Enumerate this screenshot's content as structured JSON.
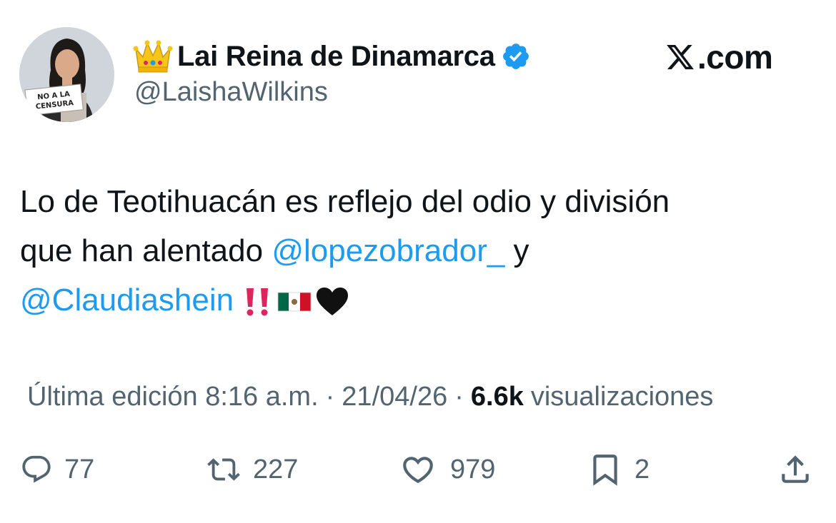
{
  "author": {
    "display_name": "Lai Reina de Dinamarca",
    "handle": "@LaishaWilkins",
    "avatar_sign_text": [
      "NO A LA",
      "CENSURA"
    ],
    "name_prefix_icon": "crown-emoji",
    "verified": true
  },
  "site": {
    "label": ".com",
    "logo_icon": "x-logo"
  },
  "tweet": {
    "lines": [
      {
        "text": "Lo de Teotihuacán es reflejo del odio y división"
      },
      {
        "text": "que han alentado ",
        "mention": "@lopezobrador_",
        "suffix": " y"
      },
      {
        "mention": "@Claudiashein",
        "emoji_icons": [
          "double-exclamation-emoji",
          "mexico-flag-emoji",
          "black-heart-emoji"
        ]
      }
    ]
  },
  "meta": {
    "edited_label": "Última edición 8:16 a.m.",
    "separator": "·",
    "date": "21/04/26",
    "views_count": "6.6k",
    "views_label": "visualizaciones"
  },
  "actions": {
    "replies": "77",
    "reposts": "227",
    "likes": "979",
    "bookmarks": "2"
  },
  "colors": {
    "text": "#0f1419",
    "secondary": "#536471",
    "mention": "#1d9bf0",
    "verified": "#1d9bf0"
  }
}
